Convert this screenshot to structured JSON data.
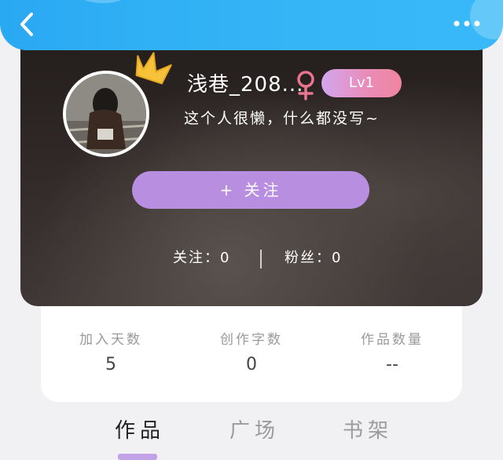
{
  "header": {
    "back_icon": "chevron-left-icon",
    "more_icon": "more-horizontal-icon"
  },
  "profile": {
    "username": "浅巷_208...",
    "gender_icon": "female-icon",
    "level": "Lv1",
    "bio": "这个人很懒，什么都没写~",
    "follow_button": "+ 关注",
    "following": "关注：0",
    "fans": "粉丝：0"
  },
  "stats": [
    {
      "label": "加入天数",
      "value": "5"
    },
    {
      "label": "创作字数",
      "value": "0"
    },
    {
      "label": "作品数量",
      "value": "--"
    }
  ],
  "tabs": [
    {
      "label": "作品",
      "active": true
    },
    {
      "label": "广场",
      "active": false
    },
    {
      "label": "书架",
      "active": false
    }
  ],
  "colors": {
    "header_blue": "#2aa9f3",
    "follow_purple": "#b88ee0",
    "level_gradient_start": "#d3a6ee",
    "level_gradient_end": "#f0849f",
    "gender_pink": "#e9748f",
    "crown_yellow": "#f6c23a",
    "tab_indicator": "#c3a3e8"
  }
}
